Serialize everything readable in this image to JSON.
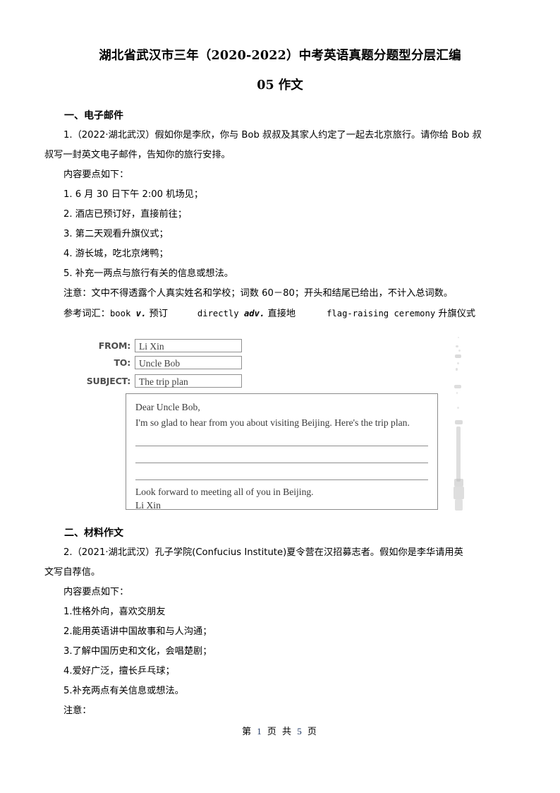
{
  "document": {
    "title": "湖北省武汉市三年（2020-2022）中考英语真题分题型分层汇编",
    "subtitle": "05 作文"
  },
  "sections": [
    {
      "heading": "一、电子邮件",
      "question_intro_line1": "1.（2022·湖北武汉）假如你是李欣，你与 Bob 叔叔及其家人约定了一起去北京旅行。请你给 Bob 叔",
      "question_intro_line2": "叔写一封英文电子邮件，告知你的旅行安排。",
      "points_label": "内容要点如下：",
      "points": [
        "1. 6 月 30 日下午 2:00 机场见；",
        "2. 酒店已预订好，直接前往；",
        "3. 第二天观看升旗仪式；",
        "4. 游长城，吃北京烤鸭；",
        "5. 补充一两点与旅行有关的信息或想法。"
      ],
      "notice": "注意：文中不得透露个人真实姓名和学校；词数 60－80；开头和结尾已给出，不计入总词数。",
      "vocab_label": "参考词汇：",
      "vocab": [
        {
          "word": "book",
          "pos": "v.",
          "meaning": "预订"
        },
        {
          "word": "directly",
          "pos": "adv.",
          "meaning": "直接地"
        },
        {
          "word": "flag-raising ceremony",
          "pos": "",
          "meaning": "升旗仪式"
        }
      ]
    },
    {
      "heading": "二、材料作文",
      "question_intro_line1": "2.（2021·湖北武汉）孔子学院(Confucius Institute)夏令营在汉招募志者。假如你是李华请用英",
      "question_intro_line2": "文写自荐信。",
      "points_label": "内容要点如下：",
      "points": [
        "1.性格外向，喜欢交朋友",
        "2.能用英语讲中国故事和与人沟通；",
        "3.了解中国历史和文化，会唱楚剧；",
        "4.爱好广泛，擅长乒乓球；",
        "5.补充两点有关信息或想法。"
      ],
      "notice": "注意："
    }
  ],
  "email_form": {
    "fields": [
      {
        "label": "FROM:",
        "value": "Li Xin"
      },
      {
        "label": "TO:",
        "value": "Uncle Bob"
      },
      {
        "label": "SUBJECT:",
        "value": "The trip plan"
      }
    ],
    "body": {
      "salutation": "Dear Uncle Bob,",
      "opening": "I'm so glad to hear from you about visiting Beijing. Here's the trip plan.",
      "blank_lines": 3,
      "closing_line1": "Look forward to meeting all of you in Beijing.",
      "closing_line2": "Li Xin"
    }
  },
  "footer": {
    "prefix": "第",
    "current_page": "1",
    "middle": "页 共",
    "total_pages": "5",
    "suffix": "页"
  },
  "colors": {
    "text": "#000000",
    "page_number": "#1f3864",
    "box_border": "#8c8c8c",
    "field_label": "#4d4d4d"
  }
}
